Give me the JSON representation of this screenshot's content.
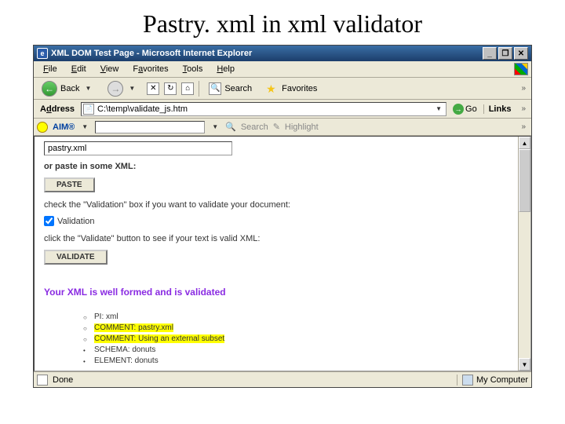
{
  "slide": {
    "title": "Pastry. xml in xml validator"
  },
  "window": {
    "title": "XML DOM Test Page - Microsoft Internet Explorer",
    "controls": {
      "min": "_",
      "max": "❐",
      "close": "✕"
    }
  },
  "menu": {
    "file": "File",
    "edit": "Edit",
    "view": "View",
    "favorites": "Favorites",
    "tools": "Tools",
    "help": "Help"
  },
  "toolbar": {
    "back": "Back",
    "search": "Search",
    "favorites": "Favorites"
  },
  "address": {
    "label": "Address",
    "value": "C:\\temp\\validate_js.htm",
    "go": "Go",
    "links": "Links"
  },
  "aim": {
    "label": "AIM®",
    "search": "Search",
    "highlight": "Highlight"
  },
  "page": {
    "file_input": "pastry.xml",
    "or_paste": "or paste in some XML:",
    "paste_btn": "PASTE",
    "check_instr": "check the \"Validation\" box if you want to validate your document:",
    "validation_label": "Validation",
    "click_instr": "click the \"Validate\" button to see if your text is valid XML:",
    "validate_btn": "VALIDATE",
    "result": "Your XML is well formed and is validated",
    "tree": {
      "pi": "PI: xml",
      "c1": "COMMENT: pastry.xml",
      "c2": "COMMENT: Using an external subset",
      "schema": "SCHEMA: donuts",
      "element": "ELEMENT: donuts"
    }
  },
  "status": {
    "done": "Done",
    "zone": "My Computer"
  }
}
